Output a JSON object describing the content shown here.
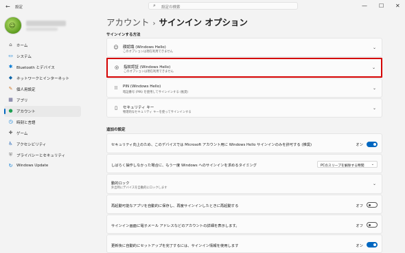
{
  "window": {
    "title": "設定",
    "minimize": "—",
    "maximize": "☐",
    "close": "✕"
  },
  "search": {
    "placeholder": "設定の検索"
  },
  "nav": {
    "items": [
      {
        "label": "ホーム"
      },
      {
        "label": "システム"
      },
      {
        "label": "Bluetooth とデバイス"
      },
      {
        "label": "ネットワークとインターネット"
      },
      {
        "label": "個人用設定"
      },
      {
        "label": "アプリ"
      },
      {
        "label": "アカウント"
      },
      {
        "label": "時刻と言語"
      },
      {
        "label": "ゲーム"
      },
      {
        "label": "アクセシビリティ"
      },
      {
        "label": "プライバシーとセキュリティ"
      },
      {
        "label": "Windows Update"
      }
    ]
  },
  "breadcrumb": {
    "parent": "アカウント",
    "separator": "›",
    "current": "サインイン オプション"
  },
  "signin_section": {
    "heading": "サインインする方法",
    "options": [
      {
        "title": "顔認識 (Windows Hello)",
        "subtitle": "このオプションは現在利用できません"
      },
      {
        "title": "指紋認証 (Windows Hello)",
        "subtitle": "このオプションは現在利用できません"
      },
      {
        "title": "PIN (Windows Hello)",
        "subtitle": "暗証番号 (PIN) を使用してサインインする (推奨)"
      },
      {
        "title": "セキュリティ キー",
        "subtitle": "物理的なセキュリティ キーを使ってサインインする"
      }
    ]
  },
  "additional_section": {
    "heading": "追加の設定",
    "rows": [
      {
        "label": "セキュリティ向上のため、このデバイスでは Microsoft アカウント用に Windows Hello サインインのみを許可する (推奨)",
        "state": "オン"
      },
      {
        "label": "しばらく操作しなかった場合に、もう一度 Windows へのサインインを求めるタイミング",
        "value": "PCのスリープを解除する時間"
      },
      {
        "label": "動的ロック",
        "sublabel": "外出時にデバイスを自動的にロックします"
      },
      {
        "label": "再起動可能なアプリを自動的に保存し、再度サインインしたときに再起動する",
        "state": "オフ"
      },
      {
        "label": "サインイン画面に電子メール アドレスなどのアカウントの詳細を表示します。",
        "state": "オフ"
      },
      {
        "label": "更新後に自動的にセットアップを完了するには、サインイン情報を使用します",
        "state": "オン"
      }
    ]
  },
  "colors": {
    "accent": "#0067c0",
    "highlight_border": "#d40000"
  }
}
